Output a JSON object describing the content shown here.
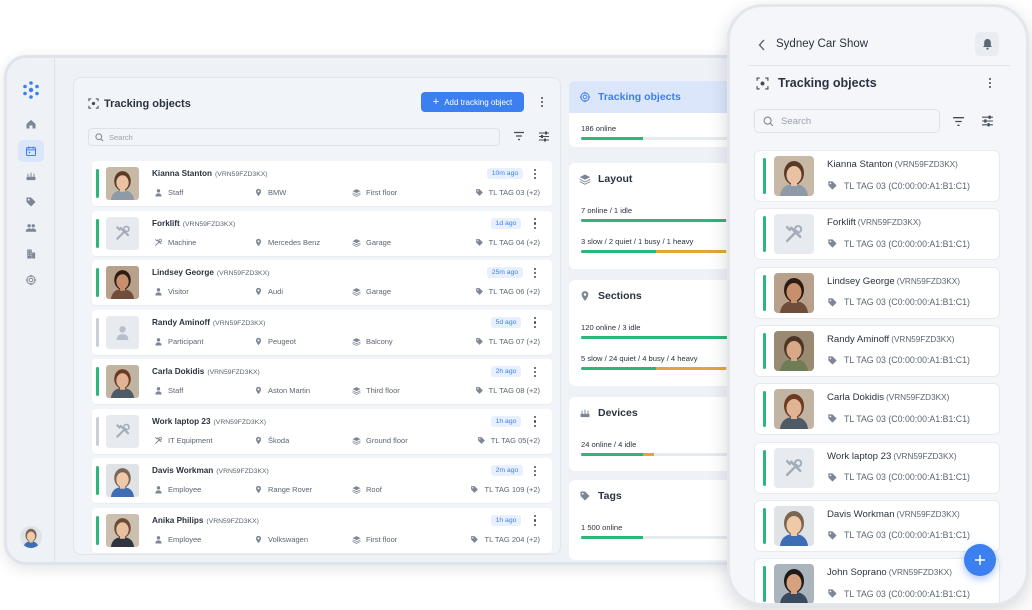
{
  "colors": {
    "accent": "#3b7ff0",
    "online": "#2cb67a",
    "warning": "#e3a53a",
    "offline": "#c9cfd8"
  },
  "rail": {
    "icons": [
      "home-icon",
      "calendar-icon",
      "router-icon",
      "tag-icon",
      "people-icon",
      "building-icon",
      "target-icon"
    ],
    "active_index": 1
  },
  "main": {
    "title": "Tracking objects",
    "add_button": "Add tracking object",
    "search_placeholder": "Search",
    "rows": [
      {
        "name": "Kianna Stanton",
        "code": "(VRN59FZD3KX)",
        "time": "10m ago",
        "type": "Staff",
        "type_icon": "person-icon",
        "location": "BMW",
        "floor": "First floor",
        "tag": "TL TAG 03 (+2)",
        "online": true,
        "pic": "face1"
      },
      {
        "name": "Forklift",
        "code": "(VRN59FZD3KX)",
        "time": "1d ago",
        "type": "Machine",
        "type_icon": "tools-icon",
        "location": "Mercedes Benz",
        "floor": "Garage",
        "tag": "TL TAG 04 (+2)",
        "online": true,
        "pic": "tools"
      },
      {
        "name": "Lindsey George",
        "code": "(VRN59FZD3KX)",
        "time": "25m ago",
        "type": "Visitor",
        "type_icon": "person-icon",
        "location": "Audi",
        "floor": "Garage",
        "tag": "TL TAG 06 (+2)",
        "online": true,
        "pic": "face2"
      },
      {
        "name": "Randy Aminoff",
        "code": "(VRN59FZD3KX)",
        "time": "5d ago",
        "type": "Participant",
        "type_icon": "person-icon",
        "location": "Peugeot",
        "floor": "Balcony",
        "tag": "TL TAG 07 (+2)",
        "online": false,
        "pic": "person"
      },
      {
        "name": "Carla Dokidis",
        "code": "(VRN59FZD3KX)",
        "time": "2h ago",
        "type": "Staff",
        "type_icon": "person-icon",
        "location": "Aston Martin",
        "floor": "Third floor",
        "tag": "TL TAG 08 (+2)",
        "online": true,
        "pic": "face3"
      },
      {
        "name": "Work laptop 23",
        "code": "(VRN59FZD3KX)",
        "time": "1h ago",
        "type": "IT Equipment",
        "type_icon": "tools-icon",
        "location": "Škoda",
        "floor": "Ground floor",
        "tag": "TL TAG 05(+2)",
        "online": false,
        "pic": "tools"
      },
      {
        "name": "Davis Workman",
        "code": "(VRN59FZD3KX)",
        "time": "2m ago",
        "type": "Employee",
        "type_icon": "person-icon",
        "location": "Range Rover",
        "floor": "Roof",
        "tag": "TL TAG 109 (+2)",
        "online": true,
        "pic": "face4"
      },
      {
        "name": "Anika Philips",
        "code": "(VRN59FZD3KX)",
        "time": "1h ago",
        "type": "Employee",
        "type_icon": "person-icon",
        "location": "Volkswagen",
        "floor": "First floor",
        "tag": "TL TAG 204 (+2)",
        "online": true,
        "pic": "face5"
      }
    ]
  },
  "side": {
    "cards": [
      {
        "title": "Tracking objects",
        "icon": "target-icon",
        "highlight": true,
        "stats": [
          {
            "text": "186 online",
            "green": 0.33,
            "amber": 0
          }
        ]
      },
      {
        "title": "Layout",
        "icon": "layers-icon",
        "highlight": false,
        "stats": [
          {
            "text": "7 online / 1 idle",
            "green": 0.77,
            "amber": 0
          },
          {
            "text": "3 slow / 2 quiet / 1 busy / 1 heavy",
            "green": 0.4,
            "amber": 0.37
          }
        ]
      },
      {
        "title": "Sections",
        "icon": "pin-icon",
        "highlight": false,
        "stats": [
          {
            "text": "120 online / 3 idle",
            "green": 0.78,
            "amber": 0
          },
          {
            "text": "5 slow / 24 quiet / 4 busy / 4 heavy",
            "green": 0.4,
            "amber": 0.37
          }
        ]
      },
      {
        "title": "Devices",
        "icon": "router-icon",
        "highlight": false,
        "stats": [
          {
            "text": "24 online / 4 idle",
            "green": 0.33,
            "amber": 0.06
          }
        ]
      },
      {
        "title": "Tags",
        "icon": "tag-icon",
        "highlight": false,
        "stats": [
          {
            "text": "1 500 online",
            "green": 0.33,
            "amber": 0
          }
        ]
      }
    ]
  },
  "phone": {
    "header_title": "Sydney Car Show",
    "title": "Tracking objects",
    "search_placeholder": "Search",
    "rows": [
      {
        "name": "Kianna Stanton",
        "code": "(VRN59FZD3KX)",
        "tag": "TL TAG 03 (C0:00:00:A1:B1:C1)",
        "pic": "face1"
      },
      {
        "name": "Forklift",
        "code": "(VRN59FZD3KX)",
        "tag": "TL TAG 03 (C0:00:00:A1:B1:C1)",
        "pic": "tools"
      },
      {
        "name": "Lindsey George",
        "code": "(VRN59FZD3KX)",
        "tag": "TL TAG 03 (C0:00:00:A1:B1:C1)",
        "pic": "face2"
      },
      {
        "name": "Randy Aminoff",
        "code": "(VRN59FZD3KX)",
        "tag": "TL TAG 03 (C0:00:00:A1:B1:C1)",
        "pic": "face6"
      },
      {
        "name": "Carla Dokidis",
        "code": "(VRN59FZD3KX)",
        "tag": "TL TAG 03 (C0:00:00:A1:B1:C1)",
        "pic": "face3"
      },
      {
        "name": "Work laptop 23",
        "code": "(VRN59FZD3KX)",
        "tag": "TL TAG 03 (C0:00:00:A1:B1:C1)",
        "pic": "tools"
      },
      {
        "name": "Davis Workman",
        "code": "(VRN59FZD3KX)",
        "tag": "TL TAG 03 (C0:00:00:A1:B1:C1)",
        "pic": "face4"
      },
      {
        "name": "John Soprano",
        "code": "(VRN59FZD3KX)",
        "tag": "TL TAG 03 (C0:00:00:A1:B1:C1)",
        "pic": "face7"
      }
    ]
  }
}
